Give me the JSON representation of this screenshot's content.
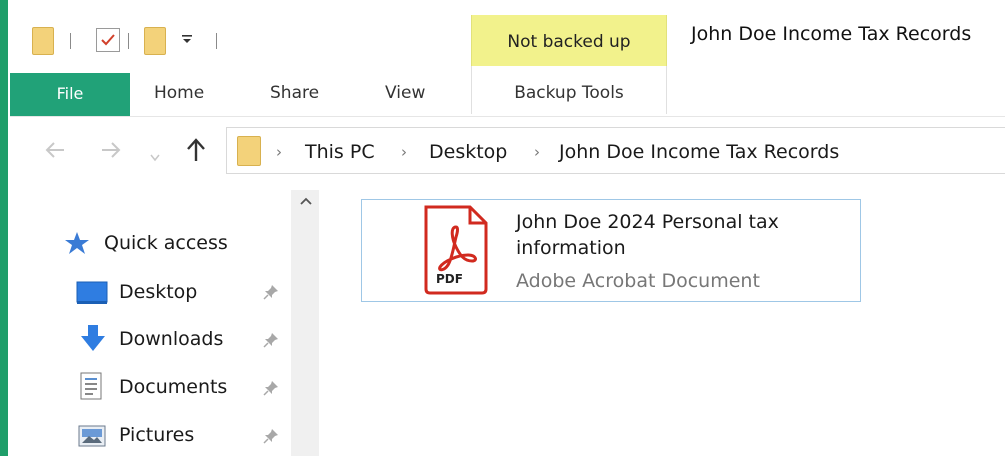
{
  "title_bar": {
    "context_tab_group": "Not backed up",
    "window_title": "John Doe Income Tax Records"
  },
  "ribbon": {
    "tabs": [
      "File",
      "Home",
      "Share",
      "View"
    ],
    "context_tab": "Backup Tools"
  },
  "address_bar": {
    "breadcrumbs": [
      "This PC",
      "Desktop",
      "John Doe Income Tax Records"
    ]
  },
  "sidebar": {
    "quick_access": "Quick access",
    "items": [
      {
        "label": "Desktop",
        "icon": "desktop-icon"
      },
      {
        "label": "Downloads",
        "icon": "downloads-icon"
      },
      {
        "label": "Documents",
        "icon": "documents-icon"
      },
      {
        "label": "Pictures",
        "icon": "pictures-icon"
      }
    ]
  },
  "file": {
    "name_line1": "John Doe 2024 Personal tax",
    "name_line2": "information",
    "type": "Adobe Acrobat Document",
    "icon_badge": "PDF"
  },
  "colors": {
    "file_tab": "#21a278",
    "context_highlight": "#f2f28c",
    "pdf_red": "#d12a1f",
    "selection_border": "#9fc7e6"
  }
}
